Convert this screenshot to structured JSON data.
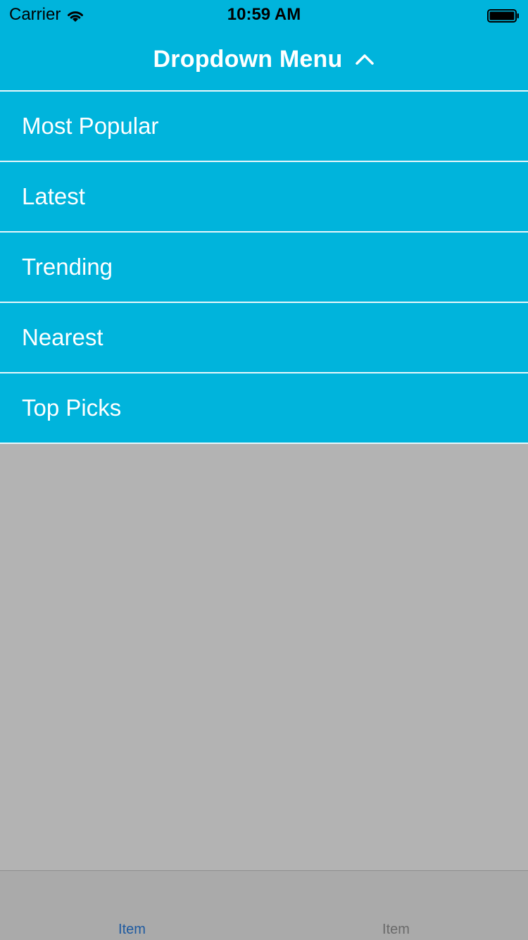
{
  "status_bar": {
    "carrier": "Carrier",
    "time": "10:59 AM",
    "wifi_icon": "wifi-icon",
    "battery_icon": "battery-icon"
  },
  "nav": {
    "title": "Dropdown Menu",
    "toggle_icon": "chevron-up-icon"
  },
  "menu": {
    "items": [
      {
        "label": "Most Popular"
      },
      {
        "label": "Latest"
      },
      {
        "label": "Trending"
      },
      {
        "label": "Nearest"
      },
      {
        "label": "Top Picks"
      }
    ]
  },
  "tab_bar": {
    "tabs": [
      {
        "label": "Item",
        "selected": true
      },
      {
        "label": "Item",
        "selected": false
      }
    ]
  },
  "colors": {
    "accent": "#00b4dc",
    "overlay": "#b3b3b3",
    "selected_tab": "#1e5aa0",
    "unselected_tab": "#6a6a6a"
  }
}
